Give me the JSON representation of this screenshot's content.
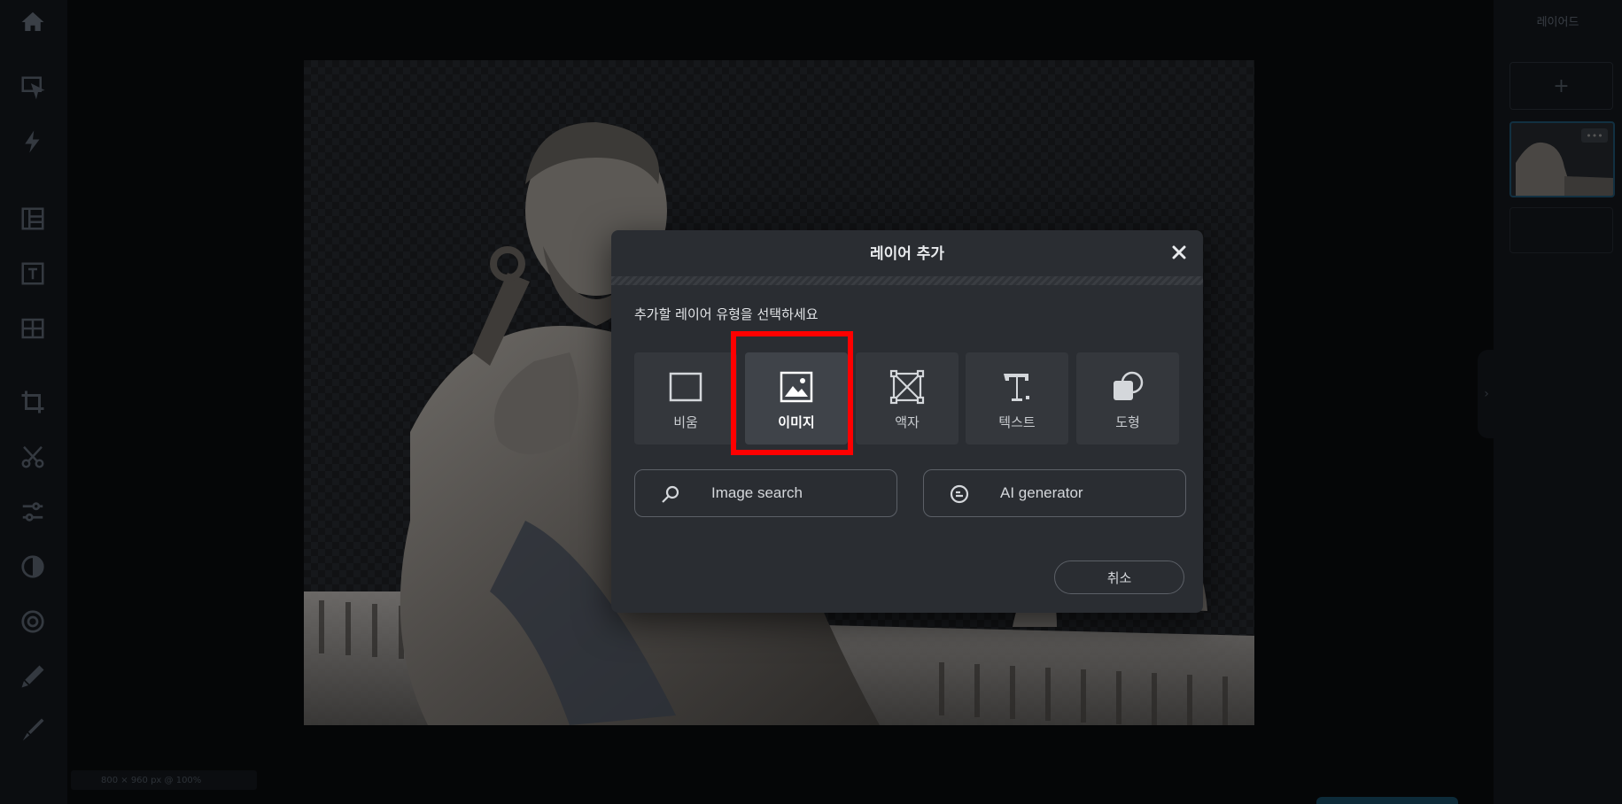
{
  "left_toolbar": {
    "items": [
      {
        "name": "home-icon"
      },
      {
        "name": "select-icon"
      },
      {
        "name": "magic-icon"
      },
      {
        "name": "layout-icon"
      },
      {
        "name": "text-template-icon"
      },
      {
        "name": "grid-icon"
      },
      {
        "name": "crop-icon"
      },
      {
        "name": "cut-icon"
      },
      {
        "name": "adjust-icon"
      },
      {
        "name": "contrast-icon"
      },
      {
        "name": "effects-icon"
      },
      {
        "name": "brush-icon"
      },
      {
        "name": "pen-icon"
      }
    ]
  },
  "right_panel": {
    "title": "레이어드",
    "add_label": "+",
    "more_label": "•••"
  },
  "status": {
    "text": "800 × 960 px @ 100%"
  },
  "dialog": {
    "title": "레이어 추가",
    "prompt": "추가할 레이어 유형을 선택하세요",
    "types": [
      {
        "label": "비움",
        "icon": "blank-square-icon"
      },
      {
        "label": "이미지",
        "icon": "image-icon",
        "selected": true
      },
      {
        "label": "액자",
        "icon": "frame-icon"
      },
      {
        "label": "텍스트",
        "icon": "text-icon"
      },
      {
        "label": "도형",
        "icon": "shape-icon"
      }
    ],
    "image_search_label": "Image search",
    "ai_generator_label": "AI generator",
    "cancel_label": "취소"
  },
  "colors": {
    "dialog_bg": "#2a2d32",
    "tile_bg": "#34373c",
    "highlight": "#ff0000"
  }
}
